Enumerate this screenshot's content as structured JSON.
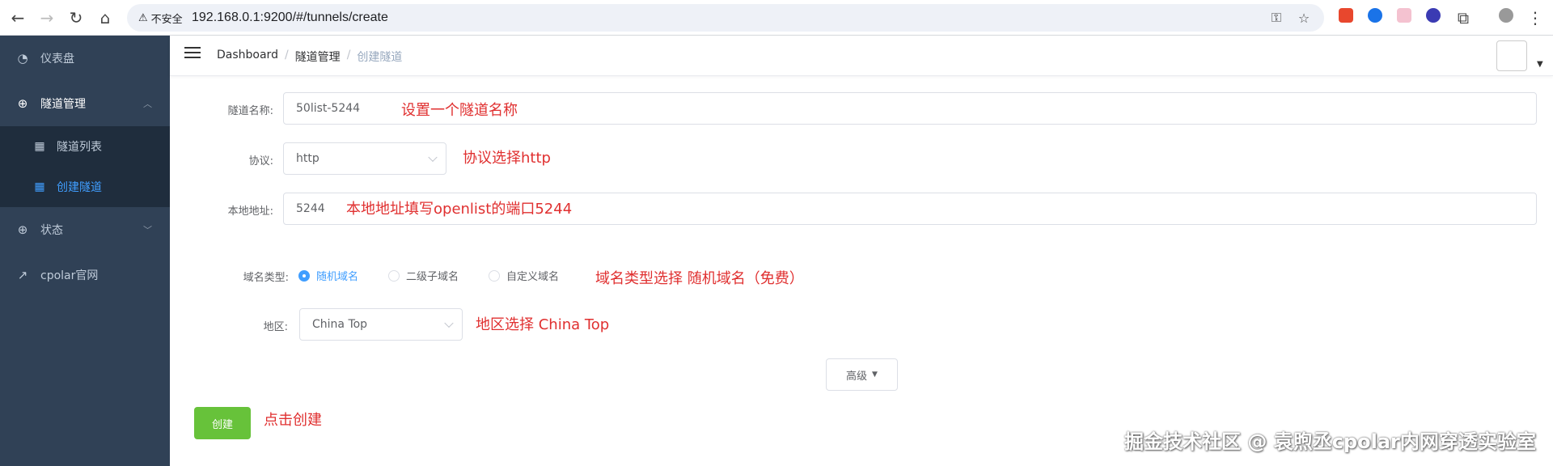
{
  "browser": {
    "insecure_label": "不安全",
    "url": "192.168.0.1:9200/#/tunnels/create"
  },
  "sidebar": {
    "items": [
      {
        "label": "仪表盘",
        "icon": "dashboard-icon"
      },
      {
        "label": "隧道管理",
        "icon": "plus-circle-icon"
      },
      {
        "label": "隧道列表",
        "icon": "grid-icon"
      },
      {
        "label": "创建隧道",
        "icon": "grid-icon"
      },
      {
        "label": "状态",
        "icon": "plus-circle-icon"
      },
      {
        "label": "cpolar官网",
        "icon": "external-link-icon"
      }
    ]
  },
  "breadcrumb": [
    "Dashboard",
    "隧道管理",
    "创建隧道"
  ],
  "form": {
    "name_label": "隧道名称:",
    "name_value": "50list-5244",
    "protocol_label": "协议:",
    "protocol_value": "http",
    "local_label": "本地地址:",
    "local_value": "5244",
    "domain_type_label": "域名类型:",
    "domain_options": [
      "随机域名",
      "二级子域名",
      "自定义域名"
    ],
    "region_label": "地区:",
    "region_value": "China Top",
    "advanced_button": "高级",
    "create_button": "创建"
  },
  "annotations": {
    "name": "设置一个隧道名称",
    "protocol": "协议选择http",
    "local": "本地地址填写openlist的端口5244",
    "domain": "域名类型选择 随机域名（免费）",
    "region": "地区选择 China Top",
    "create": "点击创建"
  },
  "watermark": "掘金技术社区 @ 袁煦丞cpolar内网穿透实验室",
  "colors": {
    "sidebar": "#304156",
    "active": "#409eff",
    "create": "#67c23a",
    "annotation": "#e03030"
  }
}
